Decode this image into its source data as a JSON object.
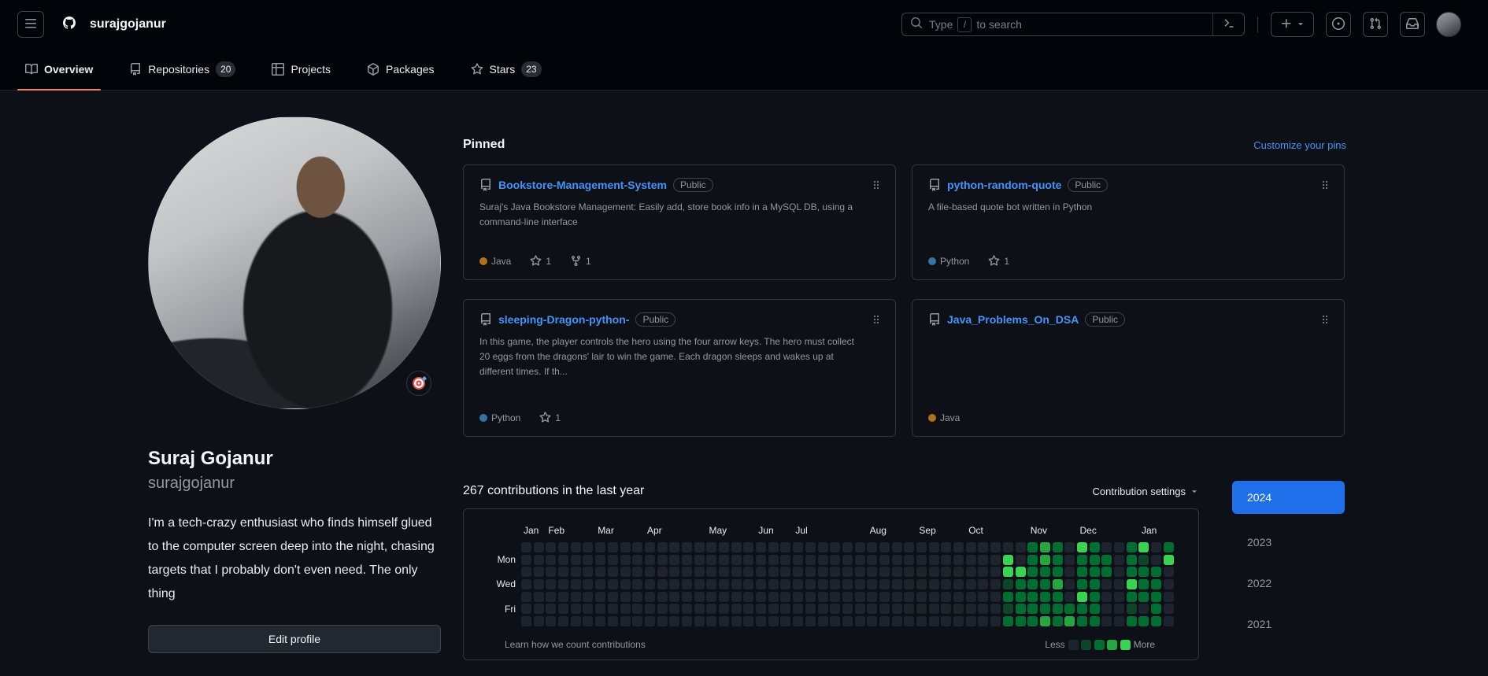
{
  "colors": {
    "accent_blue": "#1f6feb",
    "link_blue": "#4493f8",
    "tab_underline": "#f78166",
    "header_bg": "#010409",
    "page_bg": "#0d1117"
  },
  "header": {
    "username": "surajgojanur",
    "search": {
      "prefix": "Type",
      "key": "/",
      "suffix": "to search"
    }
  },
  "tabs": [
    {
      "id": "overview",
      "label": "Overview",
      "icon": "book",
      "active": true
    },
    {
      "id": "repositories",
      "label": "Repositories",
      "icon": "repo",
      "count": "20"
    },
    {
      "id": "projects",
      "label": "Projects",
      "icon": "table"
    },
    {
      "id": "packages",
      "label": "Packages",
      "icon": "package"
    },
    {
      "id": "stars",
      "label": "Stars",
      "icon": "star",
      "count": "23"
    }
  ],
  "profile": {
    "name": "Suraj Gojanur",
    "login": "surajgojanur",
    "bio": "I'm a tech-crazy enthusiast who finds himself glued to the computer screen deep into the night, chasing targets that I probably don't even need. The only thing",
    "edit_button": "Edit profile",
    "status_emoji": "target"
  },
  "pinned": {
    "title": "Pinned",
    "customize_link": "Customize your pins",
    "repos": [
      {
        "name": "Bookstore-Management-System",
        "visibility": "Public",
        "description": "Suraj's Java Bookstore Management: Easily add, store book info in a MySQL DB, using a command-line interface",
        "language": "Java",
        "language_color": "#b07219",
        "stars": "1",
        "forks": "1"
      },
      {
        "name": "python-random-quote",
        "visibility": "Public",
        "description": "A file-based quote bot written in Python",
        "language": "Python",
        "language_color": "#3572A5",
        "stars": "1",
        "forks": ""
      },
      {
        "name": "sleeping-Dragon-python-",
        "visibility": "Public",
        "description": "In this game, the player controls the hero using the four arrow keys. The hero must collect 20 eggs from the dragons' lair to win the game. Each dragon sleeps and wakes up at different times. If th...",
        "language": "Python",
        "language_color": "#3572A5",
        "stars": "1",
        "forks": ""
      },
      {
        "name": "Java_Problems_On_DSA",
        "visibility": "Public",
        "description": "",
        "language": "Java",
        "language_color": "#b07219",
        "stars": "",
        "forks": ""
      }
    ]
  },
  "contributions": {
    "title": "267 contributions in the last year",
    "settings_label": "Contribution settings",
    "months": [
      {
        "label": "Jan",
        "week": 0
      },
      {
        "label": "Feb",
        "week": 2
      },
      {
        "label": "Mar",
        "week": 6
      },
      {
        "label": "Apr",
        "week": 10
      },
      {
        "label": "May",
        "week": 15
      },
      {
        "label": "Jun",
        "week": 19
      },
      {
        "label": "Jul",
        "week": 22
      },
      {
        "label": "Aug",
        "week": 28
      },
      {
        "label": "Sep",
        "week": 32
      },
      {
        "label": "Oct",
        "week": 36
      },
      {
        "label": "Nov",
        "week": 41
      },
      {
        "label": "Dec",
        "week": 45
      },
      {
        "label": "Jan",
        "week": 50
      }
    ],
    "weekday_labels": [
      {
        "label": "Mon",
        "row": 1
      },
      {
        "label": "Wed",
        "row": 3
      },
      {
        "label": "Fri",
        "row": 5
      }
    ],
    "weeks": [
      "0000000",
      "0000000",
      "0000000",
      "0000000",
      "0000000",
      "0000000",
      "0000000",
      "0000000",
      "0000000",
      "0000000",
      "0000000",
      "0000000",
      "0000000",
      "0000000",
      "0000000",
      "0000000",
      "0000000",
      "0000000",
      "0000000",
      "0000000",
      "0000000",
      "0000000",
      "0000000",
      "0000000",
      "0000000",
      "0000000",
      "0000000",
      "0000000",
      "0000000",
      "0000000",
      "0000000",
      "0000000",
      "0000000",
      "0000000",
      "0000000",
      "0000000",
      "0000000",
      "0000000",
      "0000000",
      "0441212",
      "0042222",
      "2222222",
      "3322223",
      "2223222",
      "0000023",
      "4222422",
      "2222222",
      "0220000",
      "0000000",
      "2224212",
      "4122202",
      "0022222",
      "2400000"
    ],
    "level_colors": [
      "#1e242e",
      "#0e4429",
      "#006d32",
      "#26a641",
      "#39d353"
    ],
    "legend": {
      "less": "Less",
      "more": "More"
    },
    "footer_link": "Learn how we count contributions",
    "years": [
      "2024",
      "2023",
      "2022",
      "2021"
    ],
    "selected_year": "2024"
  }
}
